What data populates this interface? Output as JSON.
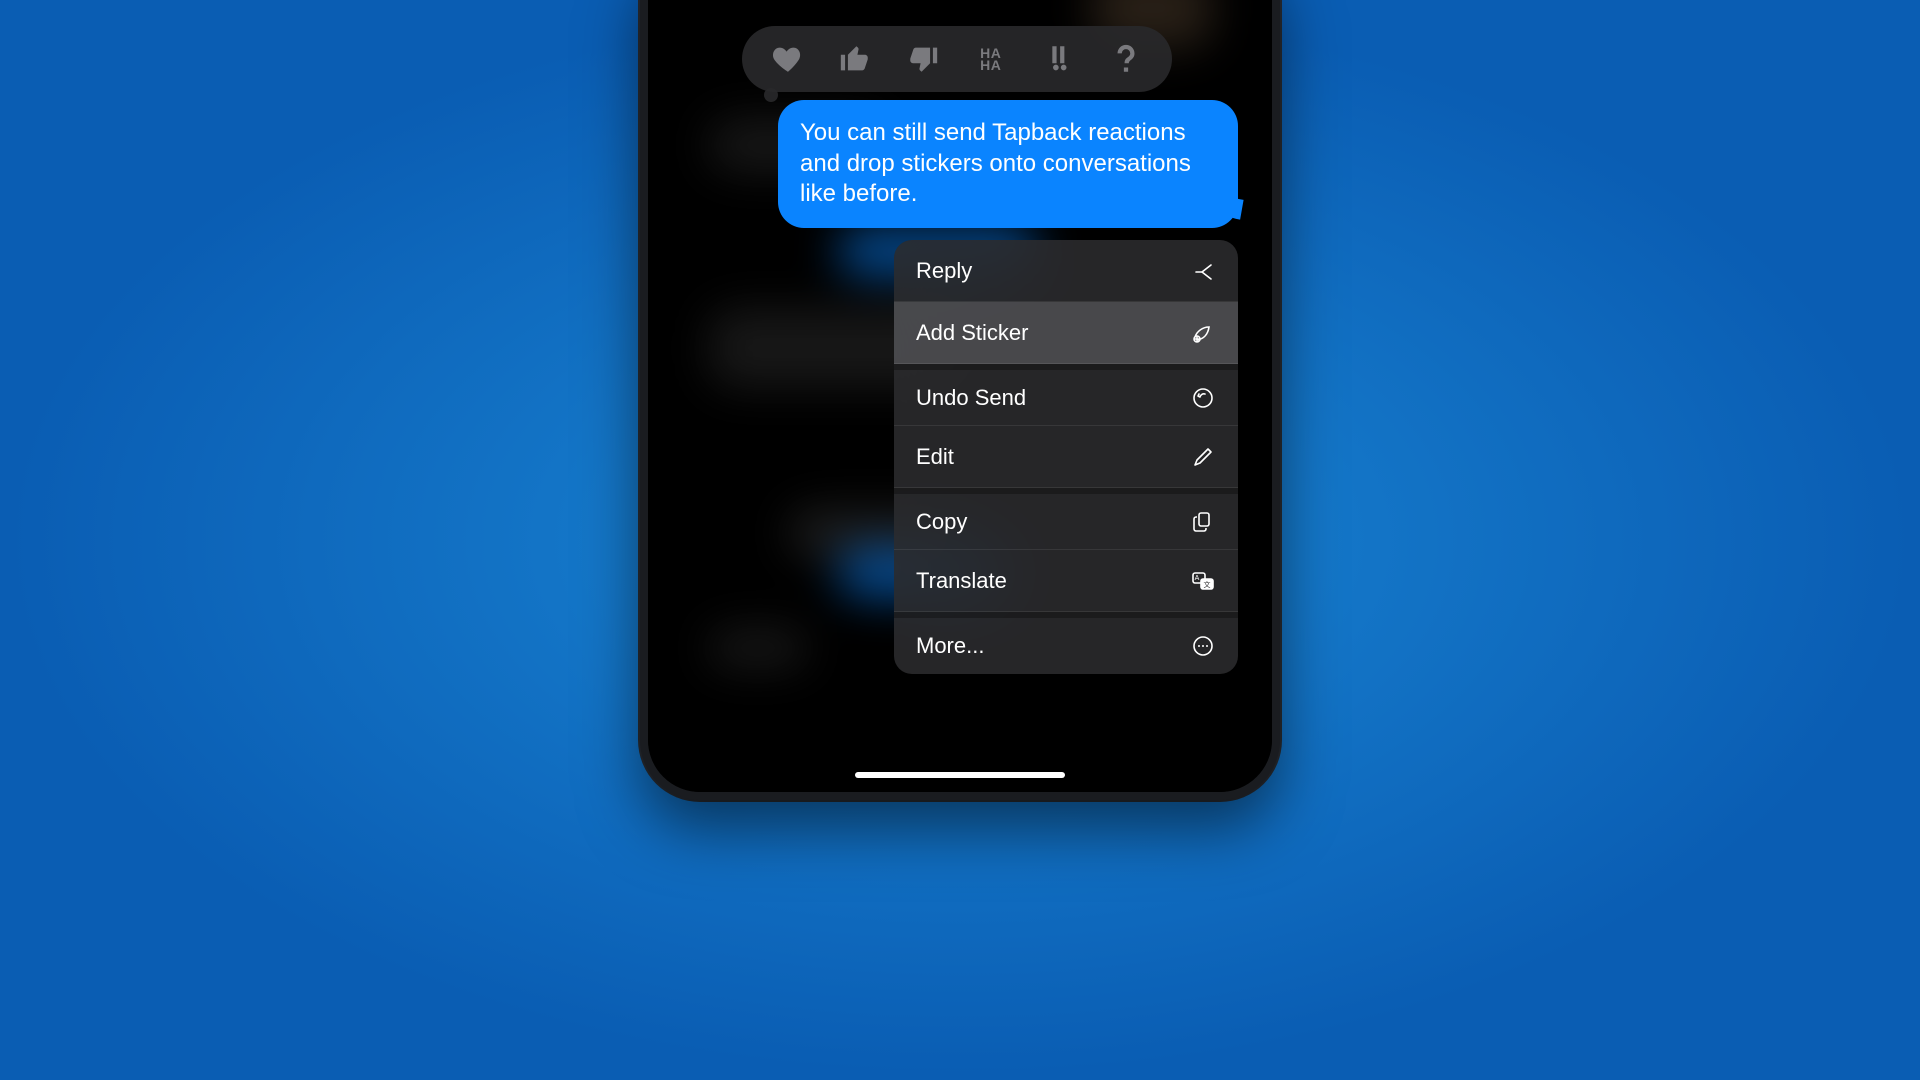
{
  "message": {
    "text": "You can still send Tapback reactions and drop stickers onto conversations like before."
  },
  "tapback": {
    "items": [
      {
        "name": "heart"
      },
      {
        "name": "thumbs-up"
      },
      {
        "name": "thumbs-down"
      },
      {
        "name": "ha-ha",
        "top": "HA",
        "bottom": "HA"
      },
      {
        "name": "exclaim"
      },
      {
        "name": "question"
      }
    ]
  },
  "menu": {
    "items": [
      {
        "label": "Reply",
        "icon": "reply-arrow",
        "highlight": false,
        "group_start": false
      },
      {
        "label": "Add Sticker",
        "icon": "sticker-add",
        "highlight": true,
        "group_start": false
      },
      {
        "label": "Undo Send",
        "icon": "undo-circle",
        "highlight": false,
        "group_start": true
      },
      {
        "label": "Edit",
        "icon": "pencil",
        "highlight": false,
        "group_start": false
      },
      {
        "label": "Copy",
        "icon": "doc-on-doc",
        "highlight": false,
        "group_start": true
      },
      {
        "label": "Translate",
        "icon": "translate",
        "highlight": false,
        "group_start": false
      },
      {
        "label": "More...",
        "icon": "ellipsis-circle",
        "highlight": false,
        "group_start": true
      }
    ]
  }
}
